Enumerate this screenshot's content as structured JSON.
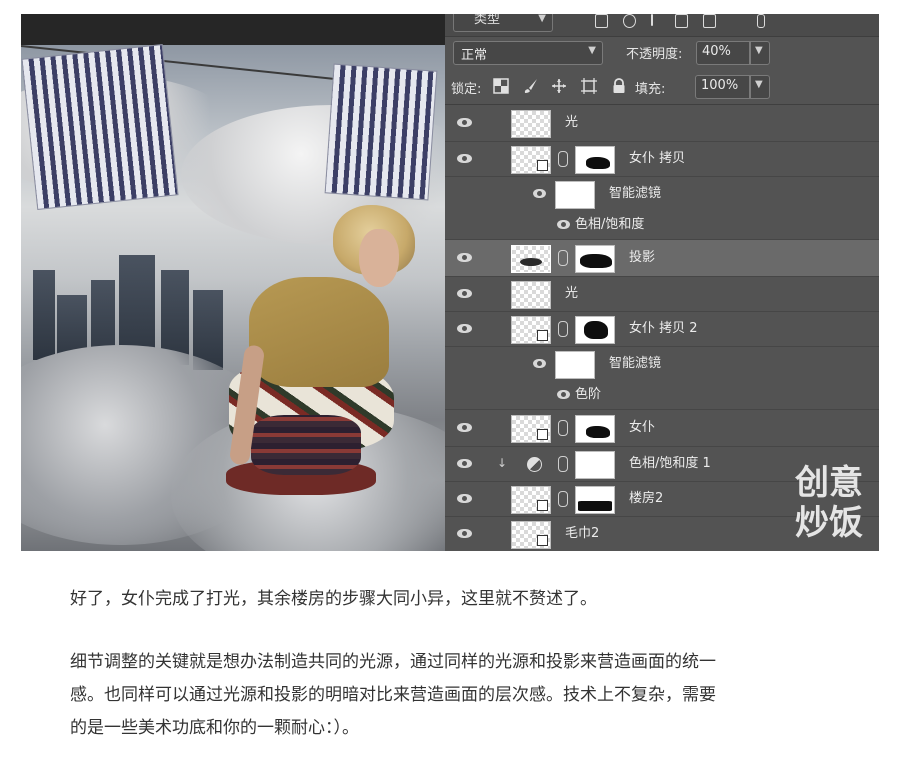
{
  "photo": {
    "description_icon": "photo-composite"
  },
  "layers_panel": {
    "kind_filter": {
      "label": "类型"
    },
    "blend_mode": "正常",
    "opacity_label": "不透明度:",
    "opacity_value": "40%",
    "lock_label": "锁定:",
    "fill_label": "填充:",
    "fill_value": "100%",
    "layers": [
      {
        "name": "光"
      },
      {
        "name": "女仆 拷贝"
      },
      {
        "name": "智能滤镜"
      },
      {
        "name": "色相/饱和度"
      },
      {
        "name": "投影"
      },
      {
        "name": "光"
      },
      {
        "name": "女仆 拷贝 2"
      },
      {
        "name": "智能滤镜"
      },
      {
        "name": "色阶"
      },
      {
        "name": "女仆"
      },
      {
        "name": "色相/饱和度 1"
      },
      {
        "name": "楼房2"
      },
      {
        "name": "毛巾2"
      }
    ]
  },
  "watermark": {
    "line1": "创意",
    "line2": "炒饭"
  },
  "article": {
    "paragraph1": "好了，女仆完成了打光，其余楼房的步骤大同小异，这里就不赘述了。",
    "paragraph2_line1": "细节调整的关键就是想办法制造共同的光源，通过同样的光源和投影来营造画面的统一",
    "paragraph2_line2": "感。也同样可以通过光源和投影的明暗对比来营造画面的层次感。技术上不复杂，需要",
    "paragraph2_line3": "的是一些美术功底和你的一颗耐心：）。"
  }
}
